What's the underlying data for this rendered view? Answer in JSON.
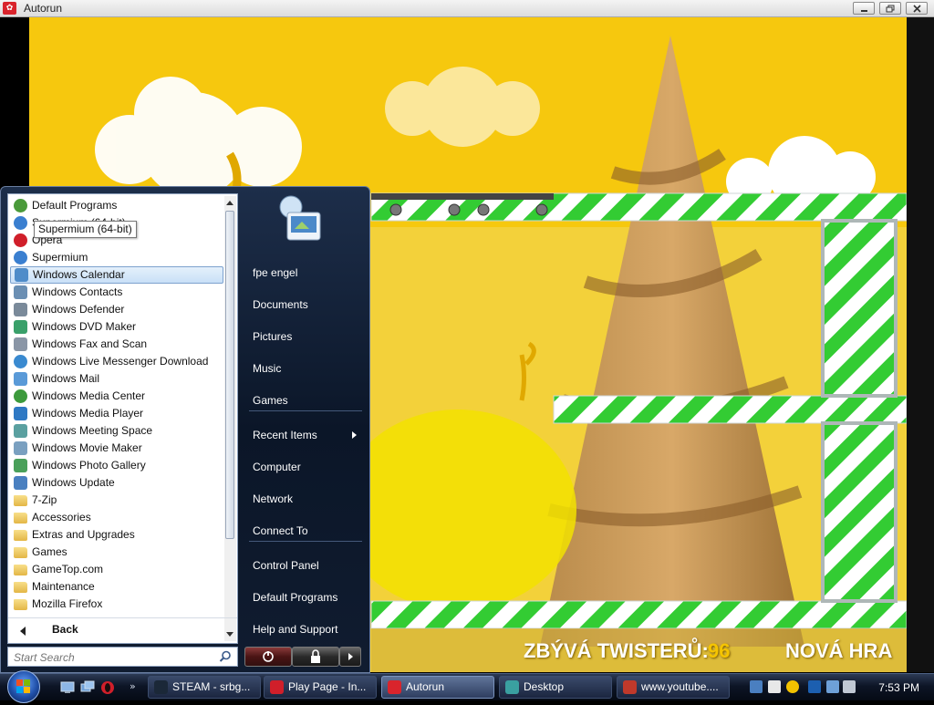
{
  "window": {
    "title": "Autorun",
    "buttons": [
      "minimize",
      "restore",
      "close"
    ]
  },
  "game": {
    "twisters_label": "ZBÝVÁ TWISTERŮ:",
    "twisters_count": "96",
    "new_game": "NOVÁ HRA"
  },
  "start_menu": {
    "tooltip": "Supermium (64-bit)",
    "programs": [
      {
        "label": "Default Programs",
        "icon": "default-programs-icon",
        "color": "#4a9a3a"
      },
      {
        "label": "Supermium (64-bit)",
        "icon": "supermium-icon",
        "color": "#3a7fd0"
      },
      {
        "label": "Opera",
        "icon": "opera-icon",
        "color": "#d01f2a"
      },
      {
        "label": "Supermium",
        "icon": "supermium-icon",
        "color": "#3a7fd0"
      },
      {
        "label": "Windows Calendar",
        "icon": "calendar-icon",
        "color": "#4f8cc9"
      },
      {
        "label": "Windows Contacts",
        "icon": "contacts-icon",
        "color": "#6b8fb3"
      },
      {
        "label": "Windows Defender",
        "icon": "defender-icon",
        "color": "#7a8a9a"
      },
      {
        "label": "Windows DVD Maker",
        "icon": "dvd-maker-icon",
        "color": "#3aa06a"
      },
      {
        "label": "Windows Fax and Scan",
        "icon": "fax-icon",
        "color": "#8a96a6"
      },
      {
        "label": "Windows Live Messenger Download",
        "icon": "messenger-icon",
        "color": "#3a8ad0"
      },
      {
        "label": "Windows Mail",
        "icon": "mail-icon",
        "color": "#5a9ad8"
      },
      {
        "label": "Windows Media Center",
        "icon": "media-center-icon",
        "color": "#3c9a3c"
      },
      {
        "label": "Windows Media Player",
        "icon": "media-player-icon",
        "color": "#2f79c4"
      },
      {
        "label": "Windows Meeting Space",
        "icon": "meeting-space-icon",
        "color": "#5aa0a0"
      },
      {
        "label": "Windows Movie Maker",
        "icon": "movie-maker-icon",
        "color": "#7aa0c0"
      },
      {
        "label": "Windows Photo Gallery",
        "icon": "photo-gallery-icon",
        "color": "#4aa05a"
      },
      {
        "label": "Windows Update",
        "icon": "update-icon",
        "color": "#4a80c0"
      },
      {
        "label": "7-Zip",
        "icon": "folder-icon",
        "folder": true
      },
      {
        "label": "Accessories",
        "icon": "folder-icon",
        "folder": true
      },
      {
        "label": "Extras and Upgrades",
        "icon": "folder-icon",
        "folder": true
      },
      {
        "label": "Games",
        "icon": "folder-icon",
        "folder": true
      },
      {
        "label": "GameTop.com",
        "icon": "folder-icon",
        "folder": true
      },
      {
        "label": "Maintenance",
        "icon": "folder-icon",
        "folder": true
      },
      {
        "label": "Mozilla Firefox",
        "icon": "folder-icon",
        "folder": true
      }
    ],
    "back_label": "Back",
    "search_placeholder": "Start Search",
    "links": [
      {
        "label": "fpe engel"
      },
      {
        "label": "Documents"
      },
      {
        "label": "Pictures"
      },
      {
        "label": "Music"
      },
      {
        "label": "Games"
      },
      {
        "label": "Recent Items",
        "submenu": true
      },
      {
        "label": "Computer"
      },
      {
        "label": "Network"
      },
      {
        "label": "Connect To"
      },
      {
        "label": "Control Panel"
      },
      {
        "label": "Default Programs"
      },
      {
        "label": "Help and Support"
      }
    ]
  },
  "taskbar": {
    "quick_launch": [
      "show-desktop-icon",
      "switch-windows-icon",
      "opera-icon"
    ],
    "tasks": [
      {
        "label": "STEAM - srbg...",
        "icon": "steam-icon",
        "color": "#1b2838"
      },
      {
        "label": "Play Page - In...",
        "icon": "opera-icon",
        "color": "#d01f2a"
      },
      {
        "label": "Autorun",
        "icon": "autorun-icon",
        "color": "#d9242c",
        "active": true
      },
      {
        "label": "Desktop",
        "icon": "folder-icon",
        "color": "#3aa0a0"
      },
      {
        "label": "www.youtube....",
        "icon": "browser-icon",
        "color": "#c0392b"
      }
    ],
    "clock": "7:53 PM"
  }
}
